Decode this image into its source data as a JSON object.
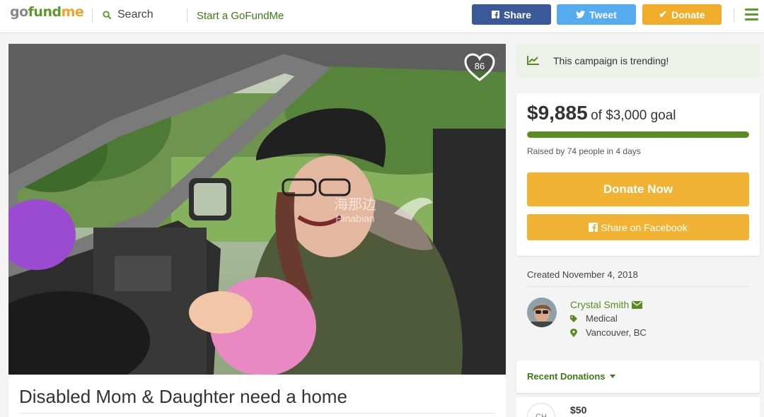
{
  "header": {
    "logo": {
      "go": "go",
      "fund": "fund",
      "me": "me"
    },
    "search_label": "Search",
    "start_label": "Start a GoFundMe",
    "share_label": "Share",
    "tweet_label": "Tweet",
    "donate_label": "Donate"
  },
  "campaign": {
    "heart_count": "86",
    "title": "Disabled Mom & Daughter need a home",
    "photo_watermark": {
      "cn": "海那边",
      "en": "Hinabian"
    }
  },
  "sidebar": {
    "trending_text": "This campaign is trending!",
    "raised_amount": "$9,885",
    "goal_text": "of $3,000 goal",
    "progress_fraction": 1.0,
    "stats_text": "Raised by 74 people in 4 days",
    "donate_now_label": "Donate Now",
    "share_facebook_label": "Share on Facebook",
    "created_text": "Created November 4, 2018",
    "organizer": {
      "name": "Crystal Smith",
      "category": "Medical",
      "location": "Vancouver, BC"
    },
    "recent_donations_label": "Recent Donations",
    "donation": {
      "initials": "CH",
      "amount": "$50"
    }
  },
  "colors": {
    "brand_green": "#5b9b2a",
    "donate_orange": "#f2b233",
    "facebook_blue": "#3b5998",
    "twitter_blue": "#55acee"
  }
}
